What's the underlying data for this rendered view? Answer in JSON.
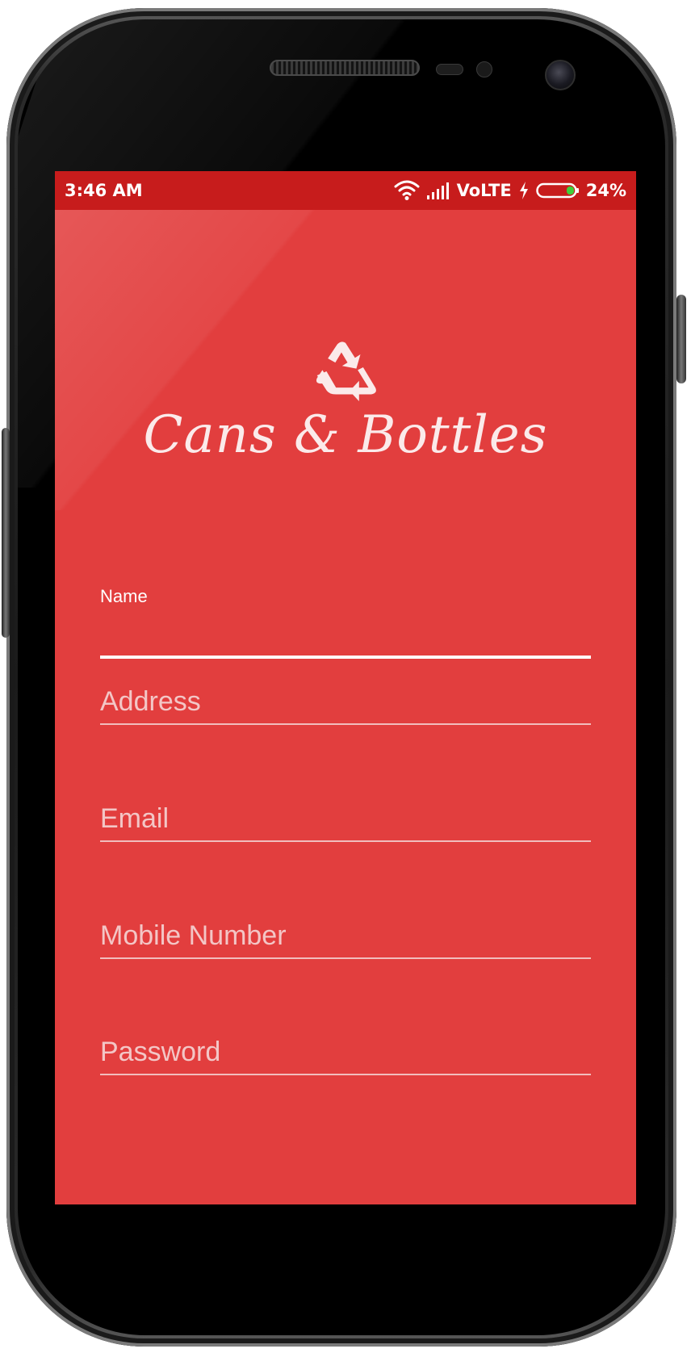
{
  "status_bar": {
    "time": "3:46 AM",
    "network": "VoLTE",
    "battery": "24%",
    "icons": [
      "wifi-icon",
      "signal-icon",
      "charging-icon",
      "battery-icon"
    ]
  },
  "app": {
    "name": "Cans & Bottles",
    "logo_icon": "recycle-icon"
  },
  "form": {
    "name": {
      "label": "Name",
      "value": ""
    },
    "address": {
      "placeholder": "Address"
    },
    "email": {
      "placeholder": "Email"
    },
    "mobile": {
      "placeholder": "Mobile Number"
    },
    "password": {
      "placeholder": "Password"
    }
  },
  "colors": {
    "background": "#e23e3e",
    "status_bar": "#c71c1c",
    "text": "#ffffff",
    "hint": "#f3c6c6"
  }
}
